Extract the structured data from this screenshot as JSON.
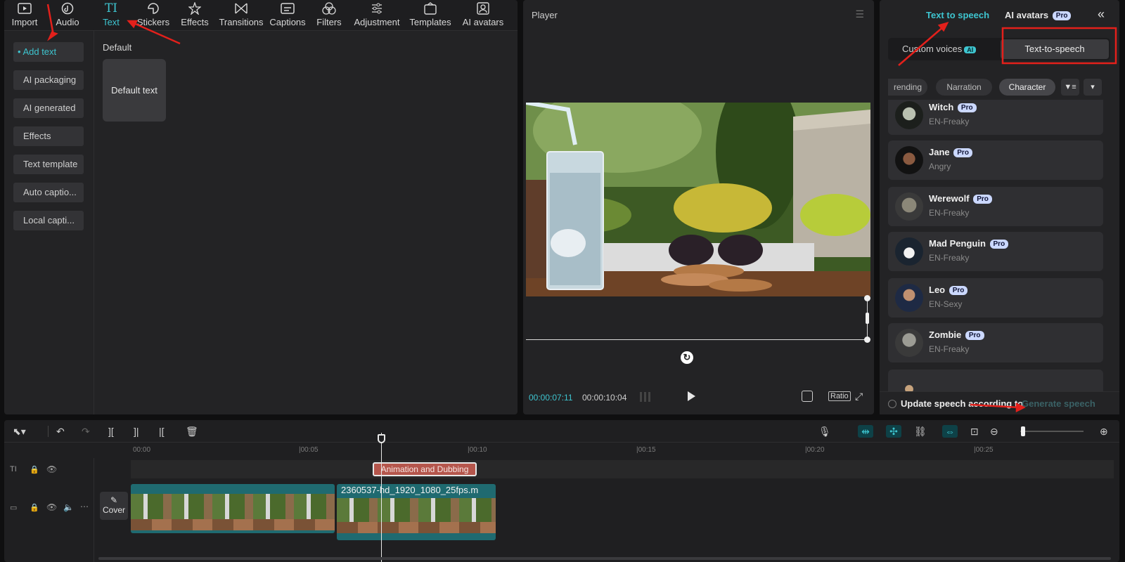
{
  "toolbar": {
    "items": [
      {
        "label": "Import",
        "icon": "import-icon"
      },
      {
        "label": "Audio",
        "icon": "audio-icon"
      },
      {
        "label": "Text",
        "icon": "text-icon",
        "glyph": "TI"
      },
      {
        "label": "Stickers",
        "icon": "sticker-icon"
      },
      {
        "label": "Effects",
        "icon": "effects-icon"
      },
      {
        "label": "Transitions",
        "icon": "transitions-icon"
      },
      {
        "label": "Captions",
        "icon": "captions-icon"
      },
      {
        "label": "Filters",
        "icon": "filters-icon"
      },
      {
        "label": "Adjustment",
        "icon": "adjustment-icon"
      },
      {
        "label": "Templates",
        "icon": "templates-icon"
      },
      {
        "label": "AI avatars",
        "icon": "ai-avatar-icon"
      }
    ],
    "active": "Text"
  },
  "side_nav": {
    "items": [
      "• Add text",
      "AI packaging",
      "AI generated",
      "Effects",
      "Text template",
      "Auto captio...",
      "Local capti..."
    ]
  },
  "text_panel": {
    "section_title": "Default",
    "card_label": "Default text"
  },
  "player": {
    "title": "Player",
    "current_time": "00:00:07:11",
    "total_time": "00:00:10:04",
    "ratio_label": "Ratio"
  },
  "right_panel": {
    "tab_tts": "Text to speech",
    "tab_avatars": "AI avatars",
    "pro_badge": "Pro",
    "segment_custom": "Custom voices",
    "ai_badge": "AI",
    "segment_tts": "Text-to-speech",
    "chips": [
      "rending",
      "Narration",
      "Character"
    ],
    "voices": [
      {
        "name": "Witch",
        "sub": "EN-Freaky"
      },
      {
        "name": "Jane",
        "sub": "Angry"
      },
      {
        "name": "Werewolf",
        "sub": "EN-Freaky"
      },
      {
        "name": "Mad Penguin",
        "sub": "EN-Freaky"
      },
      {
        "name": "Leo",
        "sub": "EN-Sexy"
      },
      {
        "name": "Zombie",
        "sub": "EN-Freaky"
      }
    ],
    "update_label": "Update speech according to",
    "generate_label": "Generate speech"
  },
  "timeline": {
    "ticks": [
      "00:00",
      "|00:05",
      "|00:10",
      "|00:15",
      "|00:20",
      "|00:25"
    ],
    "text_clip": "Animation and Dubbing",
    "video_clip_name": "2360537-hd_1920_1080_25fps.m",
    "cover_label": "Cover"
  },
  "colors": {
    "accent": "#3ec5d0",
    "annotation": "#e3201b"
  }
}
